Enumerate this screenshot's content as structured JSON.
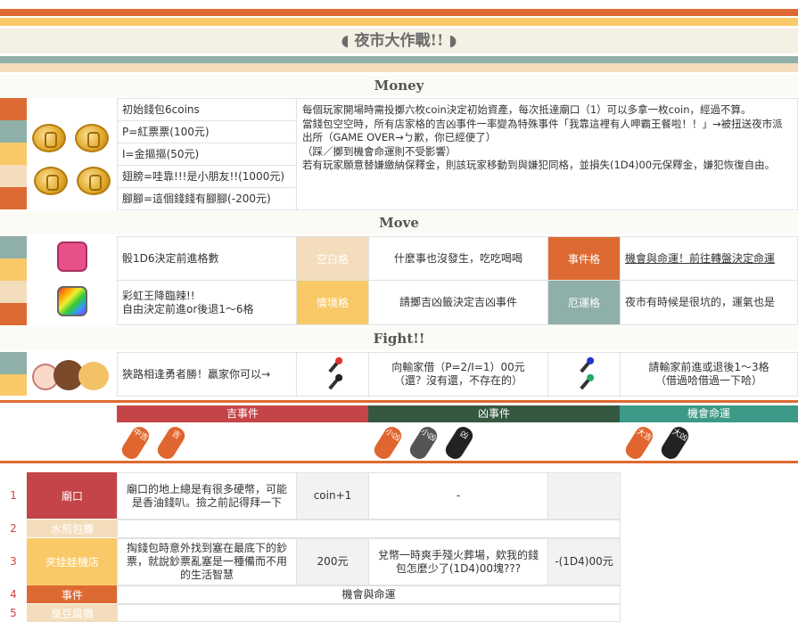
{
  "page": {
    "title": "◖ 夜市大作戰!! ◗"
  },
  "colors": {
    "orange": "#dd6a33",
    "yellow": "#f9c967",
    "teal": "#8fb0a8",
    "cream": "#f4ddbc",
    "red": "#c54448",
    "green": "#365840",
    "cyan": "#3d9988"
  },
  "money": {
    "heading": "Money",
    "rows": [
      "初始錢包6coins",
      "P=紅票票(100元)",
      "I=金摳摳(50元)",
      "翅膀=哇靠!!!是小朋友!!(1000元)",
      "腳腳=這個錢錢有腳腳(-200元)"
    ],
    "desc": "每個玩家開場時需投擲六枚coin決定初始資產，每次抵達廟口（1）可以多拿一枚coin，經過不算。\n當錢包空空時，所有店家格的吉凶事件一率變為特殊事件「我靠這裡有人呷霸王餐啦！！」→被扭送夜市派出所（GAME OVER→ㄅ歉，你已經便了）\n（踩／擲到機會命運則不受影響）\n若有玩家願意替嫌繳納保釋金，則該玩家移動到與嫌犯同格，並損失(1D4)00元保釋金，嫌犯恢復自由。"
  },
  "move": {
    "heading": "Move",
    "row1": {
      "text": "骰1D6決定前進格數",
      "tag1": "空白格",
      "desc1": "什麼事也沒發生，吃吃喝喝",
      "tag2": "事件格",
      "desc2": "機會與命運！前往轉盤決定命運"
    },
    "row2": {
      "text": "彩虹王降臨辣!!\n自由決定前進or後退1～6格",
      "tag1": "情境格",
      "desc1": "請擲吉凶籤決定吉凶事件",
      "tag2": "厄運格",
      "desc2": "夜市有時候是很坑的，運氣也是"
    }
  },
  "fight": {
    "heading": "Fight!!",
    "text": "狹路相逢勇者勝！贏家你可以→",
    "desc1": "向輸家借（P=2/I=1）00元\n（還？沒有還，不存在的）",
    "desc2": "請輸家前進或退後1～3格\n（借過哈借過一下哈）"
  },
  "events": {
    "good": {
      "label": "吉事件",
      "cards": [
        "中吉",
        "吉"
      ]
    },
    "bad": {
      "label": "凶事件",
      "cards": [
        "小凶",
        "小凶",
        "凶"
      ]
    },
    "chance": {
      "label": "機會命運",
      "cards": [
        "大吉",
        "大凶"
      ]
    }
  },
  "board": [
    {
      "n": "1",
      "name": "廟口",
      "desc": "廟口的地上總是有很多硬幣，可能是香油錢叭。撿之前記得拜一下",
      "gain": "coin+1",
      "bad": "-",
      "cost": ""
    },
    {
      "n": "2",
      "name": "水煎包攤",
      "desc": "",
      "gain": "",
      "bad": "",
      "cost": ""
    },
    {
      "n": "3",
      "name": "夾娃娃機店",
      "desc": "掏錢包時意外找到塞在最底下的鈔票，就說鈔票亂塞是一種備而不用的生活智慧",
      "gain": "200元",
      "bad": "兌幣一時爽手殘火葬場，欸我的錢包怎麼少了(1D4)00塊???",
      "cost": "-(1D4)00元"
    },
    {
      "n": "4",
      "name": "事件",
      "desc": "機會與命運"
    },
    {
      "n": "5",
      "name": "臭豆腐攤"
    }
  ]
}
